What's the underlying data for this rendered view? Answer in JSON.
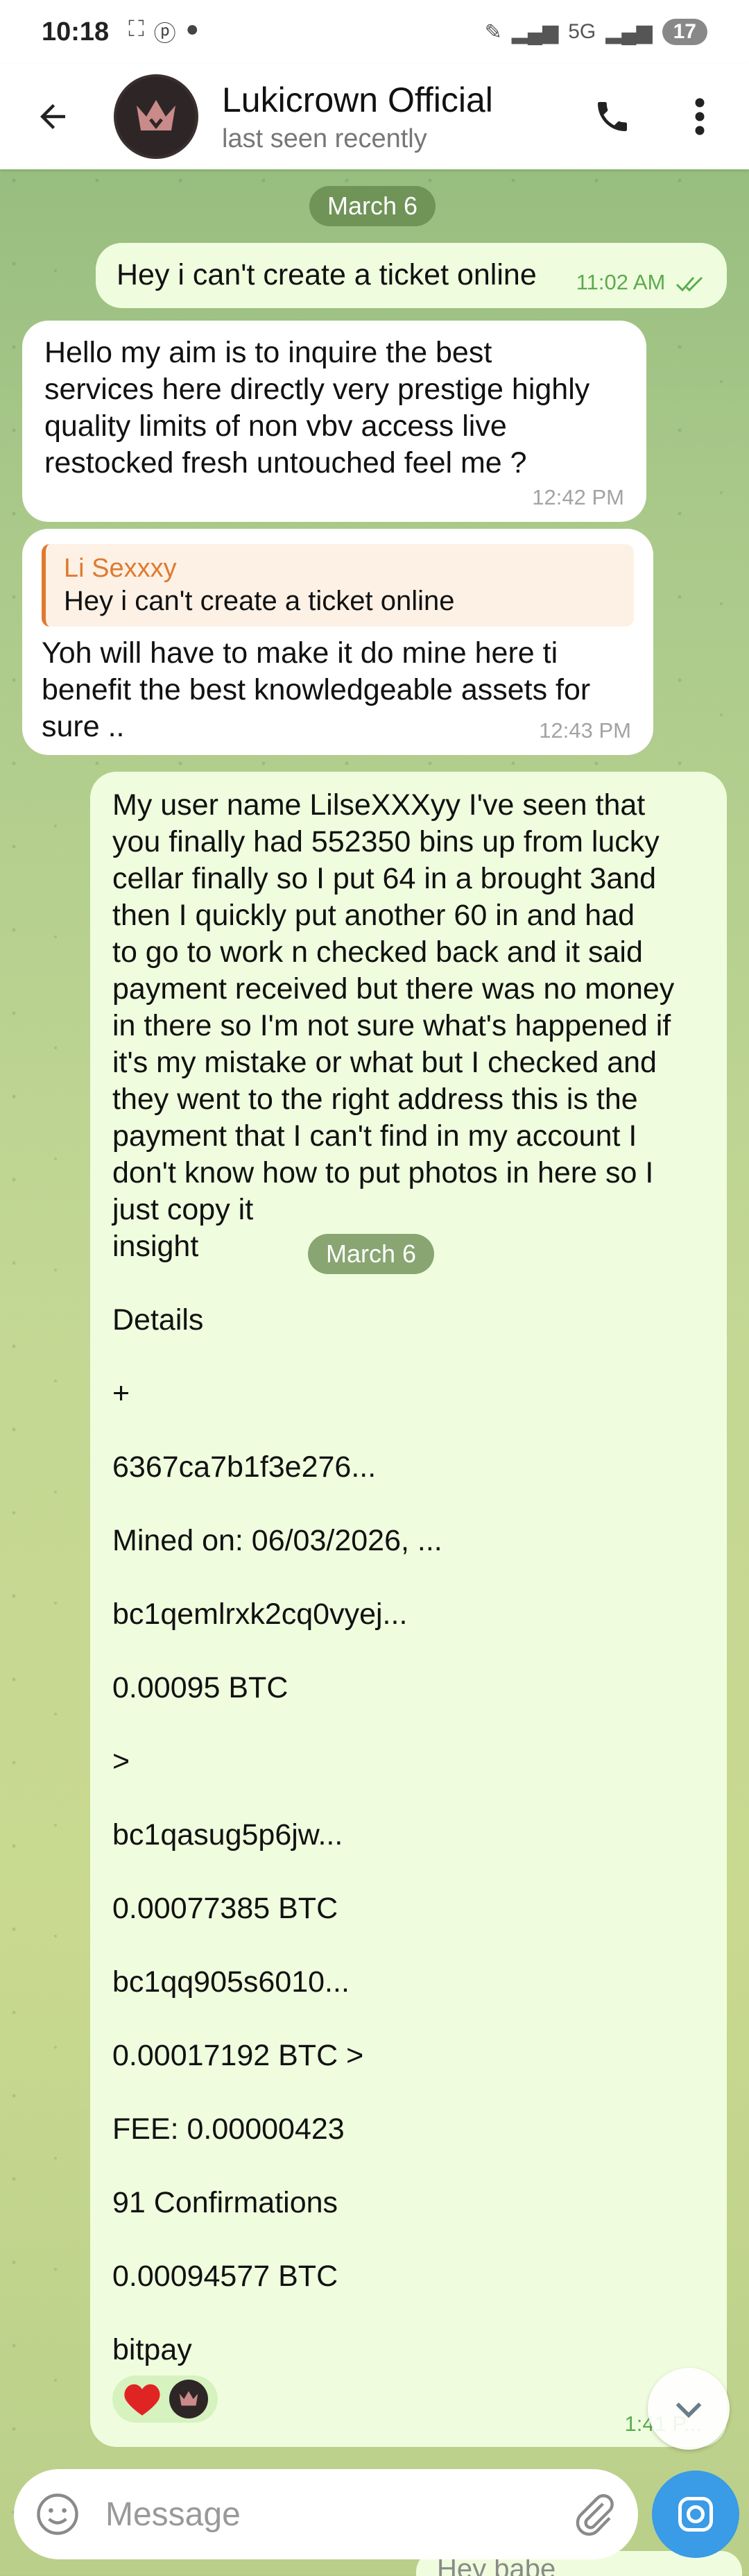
{
  "status_bar": {
    "time": "10:18",
    "network_label": "5G",
    "battery": "17"
  },
  "header": {
    "name": "Lukicrown Official",
    "status": "last seen recently"
  },
  "date_separators": [
    "March 6",
    "March 6"
  ],
  "messages": [
    {
      "direction": "out",
      "text": "Hey i can't create a ticket online",
      "time": "11:02 AM",
      "read": true
    },
    {
      "direction": "in",
      "lines": [
        "Hello my aim is to inquire the best",
        "services here directly very prestige highly",
        "quality limits of non vbv access live",
        "restocked fresh untouched feel me ?"
      ],
      "time": "12:42 PM"
    },
    {
      "direction": "in",
      "reply_to": {
        "name": "Li Sexxxy",
        "text": "Hey i can't create a ticket online"
      },
      "lines": [
        "Yoh will have to make it do mine here ti",
        "benefit the best knowledgeable assets for",
        "sure .."
      ],
      "time": "12:43 PM"
    },
    {
      "direction": "out",
      "lines": [
        "My user name LilseXXXyy  I've seen that",
        "you finally had 552350 bins up from lucky",
        "cellar finally so I put 64 in a brought 3and",
        "then I quickly put another 60 in and had",
        "to go to work n checked back and  it said",
        "payment received but there was no money",
        "in there so I'm not sure what's happened if",
        "it's my mistake or what but I checked and",
        "they went to the right address this is the",
        "payment that I can't find in my account I",
        "don't know how to put photos in here so I",
        "just copy it",
        "insight",
        "",
        "Details",
        "",
        "+",
        "",
        "6367ca7b1f3e276...",
        "",
        "Mined on: 06/03/2026, ...",
        "",
        "bc1qemlrxk2cq0vyej...",
        "",
        "0.00095 BTC",
        "",
        ">",
        "",
        "bc1qasug5p6jw...",
        "",
        "0.00077385 BTC",
        "",
        "bc1qq905s6010...",
        "",
        "0.00017192 BTC >",
        "",
        "FEE: 0.00000423",
        "",
        "91 Confirmations",
        "",
        "0.00094577 BTC",
        "",
        "bitpay"
      ],
      "time": "1:41 P...",
      "reactions": [
        "heart",
        "avatar"
      ]
    }
  ],
  "input": {
    "placeholder": "Message"
  },
  "peek_message": {
    "text": "Hey babe"
  },
  "colors": {
    "outgoing_bubble": "#effdde",
    "incoming_bubble": "#ffffff",
    "accent_blue": "#3a9be6",
    "reply_orange": "#e07a2f",
    "time_green": "#5bab4f"
  }
}
